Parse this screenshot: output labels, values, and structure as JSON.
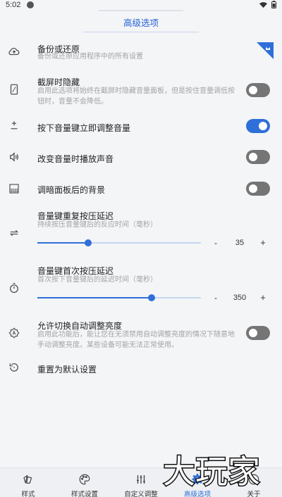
{
  "status": {
    "time": "5:02"
  },
  "header": {
    "title": "高级选项"
  },
  "settings": [
    {
      "title": "备份或还原",
      "desc": "备份或还原应用程序中的所有设置"
    },
    {
      "title": "截屏时隐藏",
      "desc": "启用此选项将始终在截屏时隐藏音量面板，但是按住音量调低按钮时，音量不会降低。",
      "enabled": false
    },
    {
      "title": "按下音量键立即调整音量",
      "enabled": true
    },
    {
      "title": "改变音量时播放声音",
      "enabled": false
    },
    {
      "title": "调暗面板后的背景",
      "enabled": false
    },
    {
      "title": "音量键重复按压延迟",
      "desc": "持续按压音量键后的反应时间（毫秒）",
      "value": "35",
      "level": 0.31
    },
    {
      "title": "音量键首次按压延迟",
      "desc": "首次按下音量键后的延迟时间（毫秒）",
      "value": "350",
      "level": 0.7
    },
    {
      "title": "允许切换自动调整亮度",
      "desc": "启用此功能后，能让您在无须禁用自动调整亮度的情况下随意地手动调整亮度。某些设备可能无法正常使用。",
      "enabled": false
    },
    {
      "title": "重置为默认设置"
    }
  ],
  "stepper": {
    "minus": "-",
    "plus": "+"
  },
  "nav": [
    {
      "label": "样式",
      "icon": "style-icon"
    },
    {
      "label": "样式设置",
      "icon": "palette-icon"
    },
    {
      "label": "自定义调整",
      "icon": "equalizer-icon"
    },
    {
      "label": "高级选项",
      "icon": "gear-icon",
      "active": true
    },
    {
      "label": "关于",
      "icon": "info-icon"
    }
  ],
  "watermark": {
    "text": "大玩家"
  },
  "colors": {
    "accent": "#2f6fd8",
    "switch_off": "#757575",
    "background": "#f4f5f7"
  }
}
